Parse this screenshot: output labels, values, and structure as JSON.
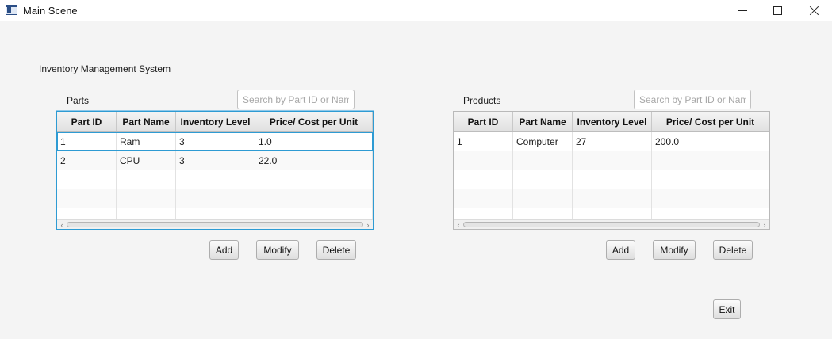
{
  "window": {
    "title": "Main Scene",
    "controls": [
      "minimize",
      "maximize",
      "close"
    ]
  },
  "app_title": "Inventory Management System",
  "parts": {
    "label": "Parts",
    "search_placeholder": "Search by Part ID or Nam",
    "columns": [
      "Part ID",
      "Part Name",
      "Inventory Level",
      "Price/ Cost per Unit"
    ],
    "rows": [
      [
        "1",
        "Ram",
        "3",
        "1.0"
      ],
      [
        "2",
        "CPU",
        "3",
        "22.0"
      ]
    ],
    "buttons": {
      "add": "Add",
      "modify": "Modify",
      "delete": "Delete"
    }
  },
  "products": {
    "label": "Products",
    "search_placeholder": "Search by Part ID or Nam",
    "columns": [
      "Part ID",
      "Part Name",
      "Inventory Level",
      "Price/ Cost per Unit"
    ],
    "rows": [
      [
        "1",
        "Computer",
        "27",
        "200.0"
      ]
    ],
    "buttons": {
      "add": "Add",
      "modify": "Modify",
      "delete": "Delete"
    }
  },
  "exit_label": "Exit",
  "colors": {
    "focus_border": "#2e9bd3",
    "background": "#f4f4f4"
  }
}
